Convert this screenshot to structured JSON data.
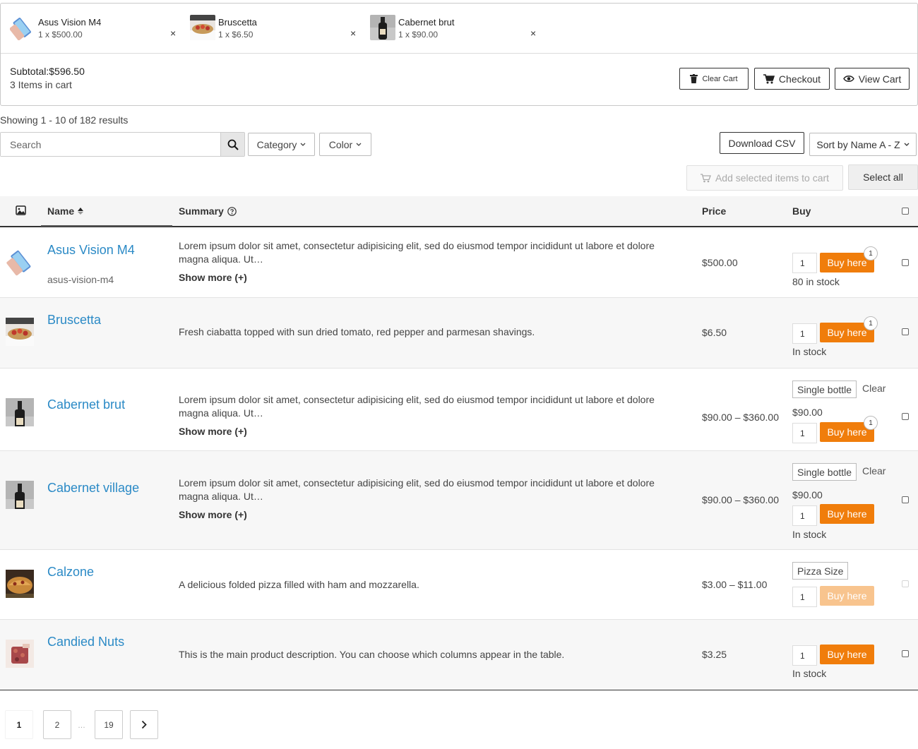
{
  "cart": {
    "items": [
      {
        "name": "Asus Vision M4",
        "qty": "1 x $500.00",
        "remove": "×",
        "thumb": "phone"
      },
      {
        "name": "Bruscetta",
        "qty": "1 x $6.50",
        "remove": "×",
        "thumb": "bruschetta"
      },
      {
        "name": "Cabernet brut",
        "qty": "1 x $90.00",
        "remove": "×",
        "thumb": "wine-bottle"
      }
    ],
    "subtotal": "Subtotal:$596.50",
    "item_count": "3 Items in cart",
    "clear_label": "Clear Cart",
    "checkout_label": "Checkout",
    "view_label": "View Cart"
  },
  "controls": {
    "results": "Showing 1 - 10 of 182 results",
    "search_placeholder": "Search",
    "category": "Category",
    "color": "Color",
    "download_csv": "Download CSV",
    "sort": "Sort by Name A - Z",
    "add_selected": "Add selected items to cart",
    "select_all": "Select all"
  },
  "table": {
    "headers": {
      "name": "Name",
      "summary": "Summary",
      "price": "Price",
      "buy": "Buy"
    },
    "buy_label": "Buy here",
    "clear_label": "Clear",
    "rows": [
      {
        "name": "Asus Vision M4",
        "sku": "asus-vision-m4",
        "summary": "Lorem ipsum dolor sit amet, consectetur adipisicing elit, sed do eiusmod tempor incididunt ut labore et dolore magna aliqua. Ut…",
        "show_more": "Show more (+)",
        "price": "$500.00",
        "qty": "1",
        "badge": "1",
        "stock": "80 in stock",
        "thumb": "phone"
      },
      {
        "name": "Bruscetta",
        "summary": "Fresh ciabatta topped with sun dried tomato, red pepper and parmesan shavings.",
        "price": "$6.50",
        "qty": "1",
        "badge": "1",
        "stock": "In stock",
        "thumb": "bruschetta"
      },
      {
        "name": "Cabernet brut",
        "summary": "Lorem ipsum dolor sit amet, consectetur adipisicing elit, sed do eiusmod tempor incididunt ut labore et dolore magna aliqua. Ut…",
        "show_more": "Show more (+)",
        "price": "$90.00 – $360.00",
        "variant": "Single bottle",
        "variant_price": "$90.00",
        "qty": "1",
        "badge": "1",
        "thumb": "wine-bottle"
      },
      {
        "name": "Cabernet village",
        "summary": "Lorem ipsum dolor sit amet, consectetur adipisicing elit, sed do eiusmod tempor incididunt ut labore et dolore magna aliqua. Ut…",
        "show_more": "Show more (+)",
        "price": "$90.00 – $360.00",
        "variant": "Single bottle",
        "variant_price": "$90.00",
        "qty": "1",
        "stock": "In stock",
        "thumb": "wine-bottle"
      },
      {
        "name": "Calzone",
        "summary": "A delicious folded pizza filled with ham and mozzarella.",
        "price": "$3.00 – $11.00",
        "variant": "Pizza Size",
        "qty": "1",
        "thumb": "calzone"
      },
      {
        "name": "Candied Nuts",
        "summary": "This is the main product description. You can choose which columns appear in the table.",
        "price": "$3.25",
        "qty": "1",
        "stock": "In stock",
        "thumb": "nuts"
      }
    ]
  },
  "pagination": {
    "pages": [
      "1",
      "2",
      "19"
    ],
    "ellipsis": "…",
    "current": "1"
  },
  "colors": {
    "accent": "#f07d0b",
    "link": "#2b8ac6"
  }
}
